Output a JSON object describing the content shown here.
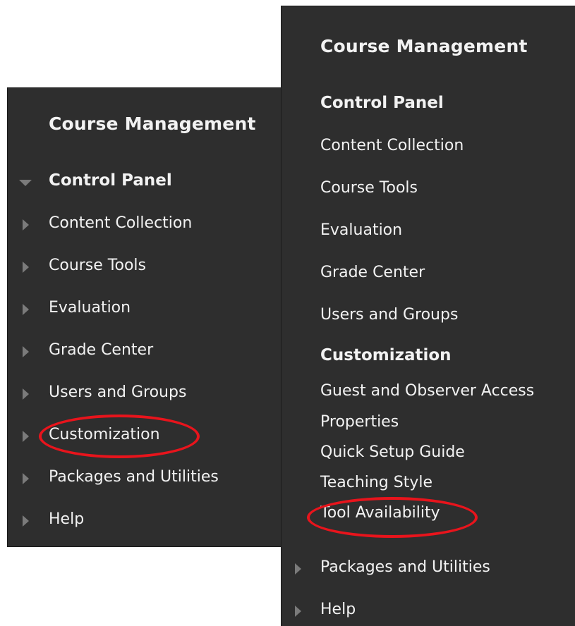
{
  "left_panel": {
    "title": "Course Management",
    "control_panel": "Control Panel",
    "items": [
      {
        "label": "Content Collection"
      },
      {
        "label": "Course Tools"
      },
      {
        "label": "Evaluation"
      },
      {
        "label": "Grade Center"
      },
      {
        "label": "Users and Groups"
      },
      {
        "label": "Customization"
      },
      {
        "label": "Packages and Utilities"
      },
      {
        "label": "Help"
      }
    ]
  },
  "right_panel": {
    "title": "Course Management",
    "control_panel": "Control Panel",
    "items": [
      {
        "label": "Content Collection"
      },
      {
        "label": "Course Tools"
      },
      {
        "label": "Evaluation"
      },
      {
        "label": "Grade Center"
      },
      {
        "label": "Users and Groups"
      }
    ],
    "customization_heading": "Customization",
    "customization_items": [
      {
        "label": "Guest and Observer Access"
      },
      {
        "label": "Properties"
      },
      {
        "label": "Quick Setup Guide"
      },
      {
        "label": "Teaching Style"
      },
      {
        "label": "Tool Availability"
      }
    ],
    "bottom_items": [
      {
        "label": "Packages and Utilities"
      },
      {
        "label": "Help"
      }
    ]
  },
  "colors": {
    "panel_background": "#2e2e2e",
    "text": "#f2f2f2",
    "arrow": "#7b7b7b",
    "highlight_circle": "#e8141c"
  },
  "icons": [
    "expand-arrow-icon",
    "collapse-arrow-icon"
  ]
}
